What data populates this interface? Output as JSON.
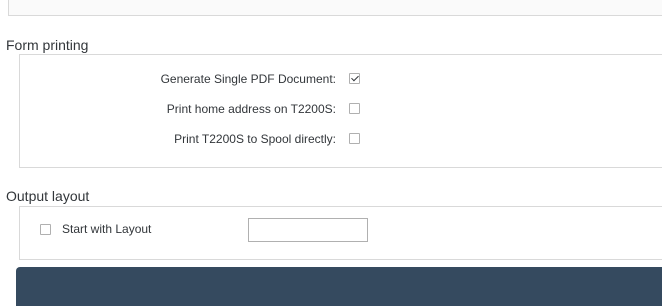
{
  "form_printing": {
    "title": "Form printing",
    "options": [
      {
        "label": "Generate Single PDF Document:",
        "checked": true
      },
      {
        "label": "Print home address on T2200S:",
        "checked": false
      },
      {
        "label": "Print T2200S to Spool directly:",
        "checked": false
      }
    ]
  },
  "output_layout": {
    "title": "Output layout",
    "start_with_layout_label": "Start with Layout",
    "start_with_layout_checked": false,
    "layout_value": ""
  }
}
